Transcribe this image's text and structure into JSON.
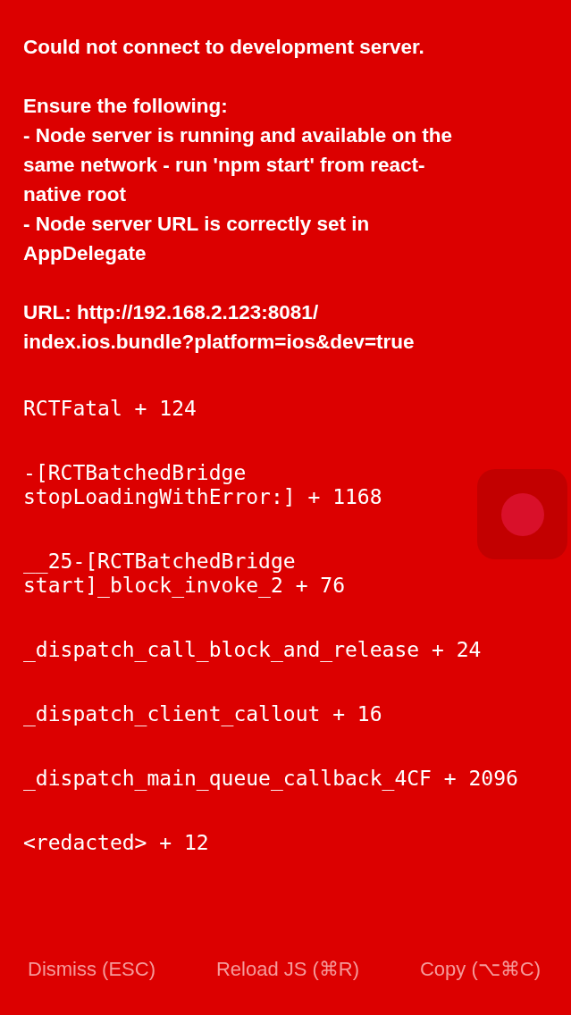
{
  "message": [
    "Could not connect to development server.",
    "Ensure the following:\n- Node server is running and available on the\nsame network - run 'npm start' from react-\nnative root\n- Node server URL is correctly set in\nAppDelegate",
    "URL: http://192.168.2.123:8081/\nindex.ios.bundle?platform=ios&dev=true"
  ],
  "stack": [
    "RCTFatal + 124",
    "-[RCTBatchedBridge\nstopLoadingWithError:] + 1168",
    "__25-[RCTBatchedBridge\nstart]_block_invoke_2 + 76",
    "_dispatch_call_block_and_release + 24",
    "_dispatch_client_callout + 16",
    "_dispatch_main_queue_callback_4CF + 2096",
    "<redacted> + 12"
  ],
  "buttons": [
    "Dismiss (ESC)",
    "Reload JS (⌘R)",
    "Copy (⌥⌘C)"
  ]
}
